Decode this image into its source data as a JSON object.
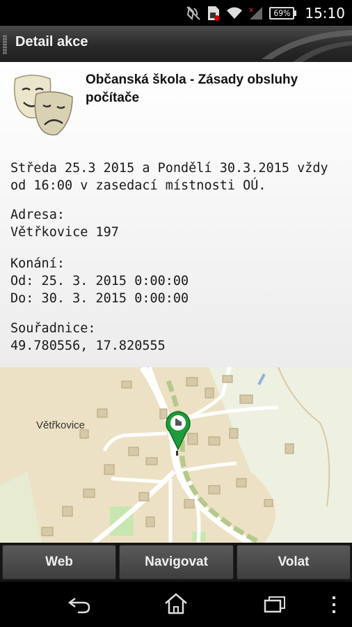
{
  "status": {
    "battery": "69%",
    "time": "15:10"
  },
  "header": {
    "title": "Detail akce"
  },
  "event": {
    "title": "Občanská škola - Zásady obsluhy počítače",
    "description": "Středa 25.3 2015 a Pondělí 30.3.2015 vždy od 16:00 v zasedací místnosti OÚ.",
    "address_label": "Adresa:",
    "address": "Větřkovice 197",
    "date_label": "Konání:",
    "date_from": "Od: 25. 3. 2015 0:00:00",
    "date_to": "Do: 30. 3. 2015 0:00:00",
    "coords_label": "Souřadnice:",
    "coords": "49.780556, 17.820555"
  },
  "map": {
    "place_label": "Větřkovice"
  },
  "buttons": {
    "web": "Web",
    "navigate": "Navigovat",
    "call": "Volat"
  },
  "icons": [
    "silent-mode-icon",
    "sim-card-icon",
    "wifi-icon",
    "signal-icon",
    "battery-icon",
    "drama-masks-icon",
    "map-pin-icon",
    "back-icon",
    "home-icon",
    "recent-apps-icon",
    "overflow-menu-icon"
  ]
}
